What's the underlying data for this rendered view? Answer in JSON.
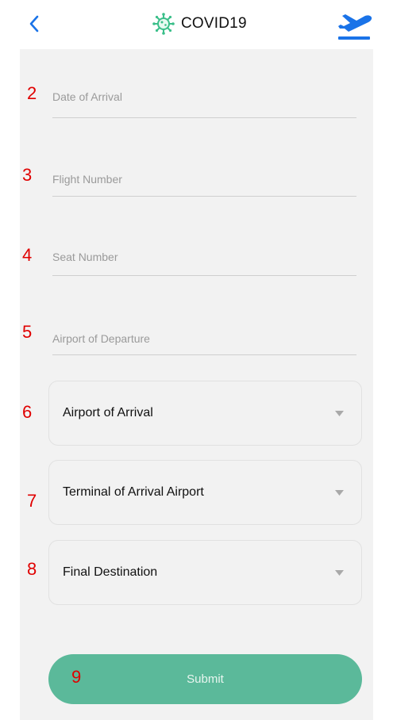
{
  "header": {
    "title": "COVID19",
    "back_icon": "chevron-left-icon",
    "logo_icon": "virus-icon",
    "plane_icon": "airplane-takeoff-icon",
    "accent_color": "#1a73e8"
  },
  "annotations": [
    "2",
    "3",
    "4",
    "5",
    "6",
    "7",
    "8",
    "9"
  ],
  "fields": {
    "date_of_arrival": {
      "placeholder": "Date of Arrival"
    },
    "flight_number": {
      "placeholder": "Flight Number"
    },
    "seat_number": {
      "placeholder": "Seat Number"
    },
    "airport_of_departure": {
      "placeholder": "Airport of Departure"
    }
  },
  "selects": {
    "airport_of_arrival": {
      "label": "Airport of Arrival"
    },
    "terminal_of_arrival": {
      "label": "Terminal of Arrival Airport"
    },
    "final_destination": {
      "label": "Final Destination"
    }
  },
  "submit": {
    "label": "Submit",
    "color": "#5bb99a"
  }
}
